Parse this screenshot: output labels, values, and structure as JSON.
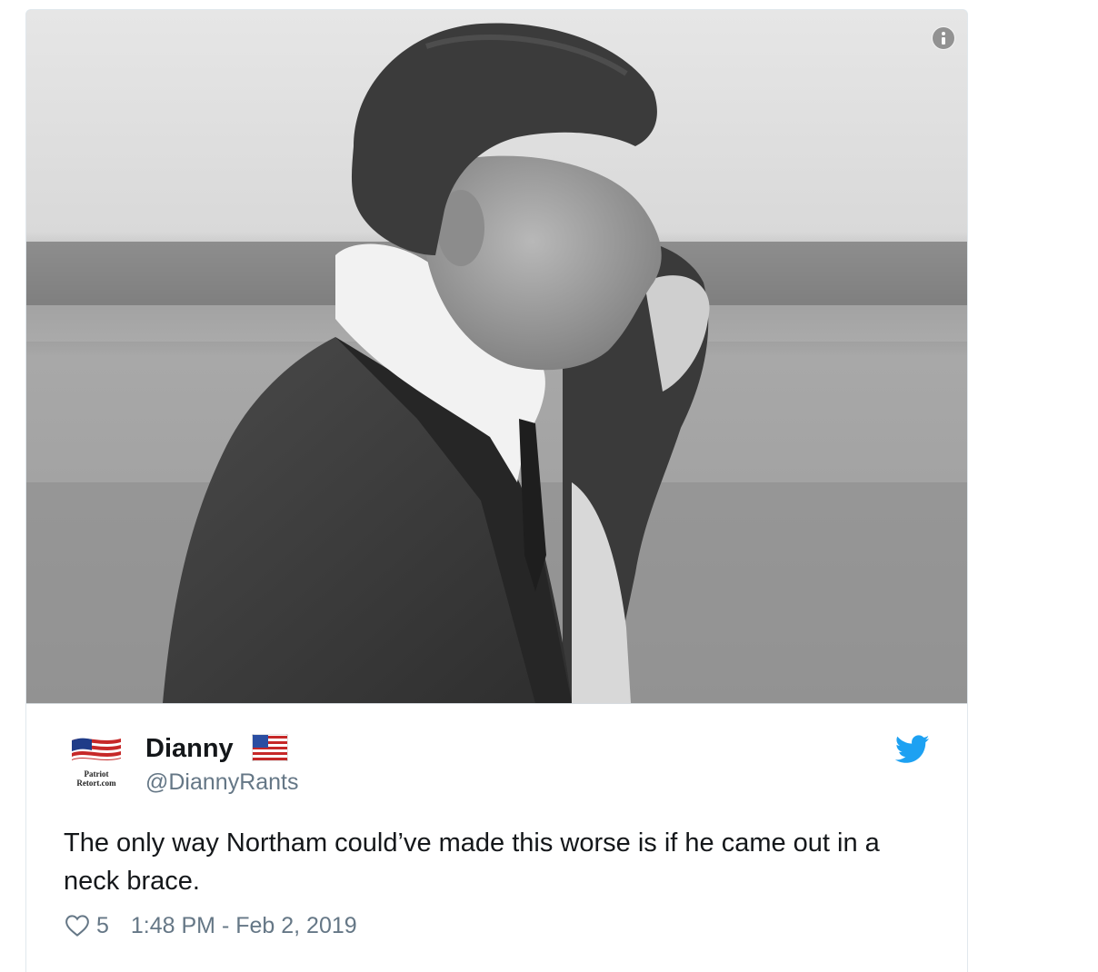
{
  "tweet": {
    "author": {
      "display_name": "Dianny",
      "handle": "@DiannyRants",
      "avatar_caption_line1": "Patriot",
      "avatar_caption_line2": "Retort.com",
      "name_badge_icon": "us-flag-icon"
    },
    "text": "The only way Northam could’ve made this worse is if he came out in a neck brace.",
    "likes": "5",
    "timestamp": "1:48 PM - Feb 2, 2019",
    "icons": {
      "like": "heart-icon",
      "brand": "twitter-bird-icon",
      "info": "info-icon"
    },
    "colors": {
      "text": "#14171a",
      "secondary": "#657786",
      "twitter_blue": "#1da1f2",
      "border": "#e1e8ed"
    }
  }
}
